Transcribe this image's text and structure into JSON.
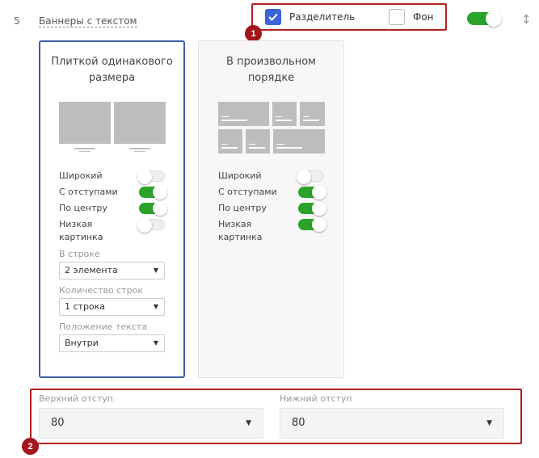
{
  "row": {
    "number": "5",
    "title": "Баннеры с текстом"
  },
  "header_options": {
    "separator": {
      "label": "Разделитель",
      "checked": true
    },
    "background": {
      "label": "Фон",
      "checked": false
    }
  },
  "main_toggle": {
    "on": true
  },
  "annotations": {
    "badge1": "1",
    "badge2": "2"
  },
  "cards": [
    {
      "title_line1": "Плиткой одинакового",
      "title_line2": "размера",
      "selected": true,
      "options": [
        {
          "label": "Широкий",
          "on": false
        },
        {
          "label": "С отступами",
          "on": true
        },
        {
          "label": "По центру",
          "on": true
        },
        {
          "label_line1": "Низкая",
          "label_line2": "картинка",
          "on": false
        }
      ],
      "selects": [
        {
          "label": "В строке",
          "value": "2 элемента"
        },
        {
          "label": "Количество строк",
          "value": "1 строка"
        },
        {
          "label": "Положение текста",
          "value": "Внутри"
        }
      ]
    },
    {
      "title_line1": "В произвольном",
      "title_line2": "порядке",
      "selected": false,
      "options": [
        {
          "label": "Широкий",
          "on": false
        },
        {
          "label": "С отступами",
          "on": true
        },
        {
          "label": "По центру",
          "on": true
        },
        {
          "label_line1": "Низкая",
          "label_line2": "картинка",
          "on": true
        }
      ]
    }
  ],
  "padding": {
    "top": {
      "label": "Верхний отступ",
      "value": "80"
    },
    "bottom": {
      "label": "Нижний отступ",
      "value": "80"
    }
  },
  "colors": {
    "accent": "#3d63d8",
    "toggle_on": "#2aa32a",
    "annotation": "#b21f1f",
    "card_border": "#3d5ea8"
  },
  "icons": {
    "check": "check-icon",
    "drag": "drag-updown-icon",
    "dropdown": "caret-down-icon"
  }
}
